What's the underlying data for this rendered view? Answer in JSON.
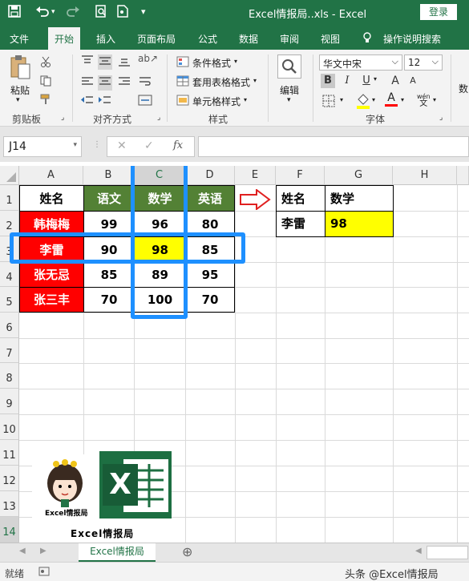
{
  "titlebar": {
    "title": "Excel情报局..xls  -  Excel",
    "login": "登录",
    "qa_save_icon": "save-icon",
    "qa_undo_icon": "undo-icon",
    "qa_redo_icon": "redo-icon"
  },
  "tabs": [
    "文件",
    "开始",
    "插入",
    "页面布局",
    "公式",
    "数据",
    "审阅",
    "视图",
    "操作说明搜索"
  ],
  "ribbon": {
    "clipboard": {
      "paste": "粘贴",
      "group": "剪贴板"
    },
    "alignment": {
      "group": "对齐方式"
    },
    "styles": {
      "conditional": "条件格式",
      "table": "套用表格格式",
      "cell": "单元格样式",
      "group": "样式"
    },
    "editing": {
      "edit": "编辑"
    },
    "font": {
      "name": "华文中宋",
      "size": "12",
      "bold": "B",
      "italic": "I",
      "underline": "U",
      "grow": "A",
      "shrink": "A",
      "wen": "wén",
      "group": "字体"
    },
    "right_cut": "数"
  },
  "formula": {
    "namebox": "J14",
    "cancel": "✕",
    "enter": "✓",
    "fx": "fx",
    "value": ""
  },
  "grid": {
    "columns": [
      "A",
      "B",
      "C",
      "D",
      "E",
      "F",
      "G",
      "H"
    ],
    "rows": [
      "1",
      "2",
      "3",
      "4",
      "5",
      "6",
      "7",
      "8",
      "9",
      "10",
      "11",
      "12",
      "13",
      "14"
    ],
    "table1_header": [
      "姓名",
      "语文",
      "数学",
      "英语"
    ],
    "table1_rows": [
      [
        "韩梅梅",
        "99",
        "96",
        "80"
      ],
      [
        "李雷",
        "90",
        "98",
        "85"
      ],
      [
        "张无忌",
        "85",
        "89",
        "95"
      ],
      [
        "张三丰",
        "70",
        "100",
        "70"
      ]
    ],
    "table2_header": [
      "姓名",
      "数学"
    ],
    "table2_row": [
      "李雷",
      "98"
    ]
  },
  "logo": {
    "avatar_caption": "Excel情报局",
    "bottom_text": "Excel情报局",
    "excel_letter": "X"
  },
  "sheetbar": {
    "tab": "Excel情报局",
    "add": "⊕"
  },
  "statusbar": {
    "ready": "就绪"
  },
  "watermark": "头条 @Excel情报局",
  "colors": {
    "excel_green": "#217346",
    "header_green": "#538135",
    "name_red": "#ff0000",
    "highlight_yellow": "#ffff00",
    "blue_highlight": "#1e90ff"
  }
}
